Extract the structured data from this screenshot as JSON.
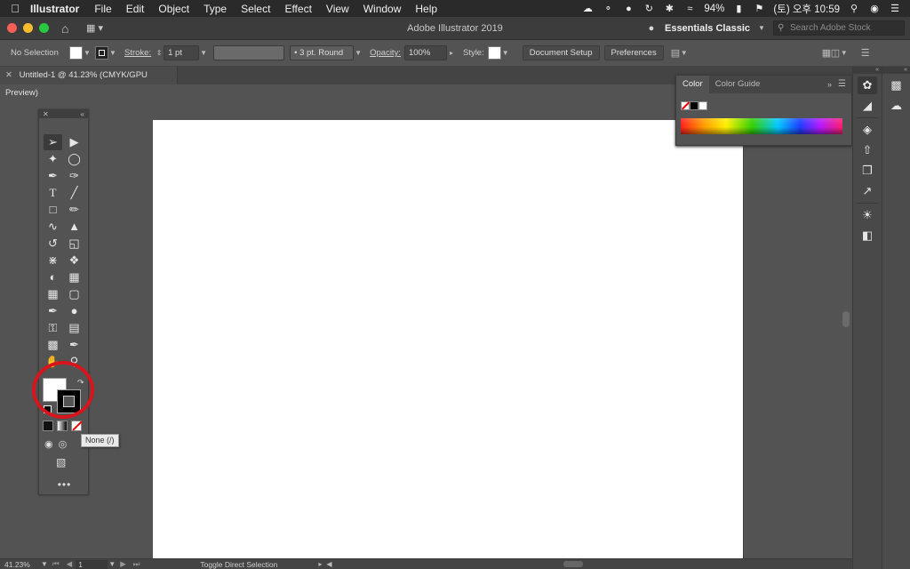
{
  "menubar": {
    "app_name": "Illustrator",
    "items": [
      "File",
      "Edit",
      "Object",
      "Type",
      "Select",
      "Effect",
      "View",
      "Window",
      "Help"
    ],
    "battery": "94%",
    "clock": "(토) 오후 10:59"
  },
  "titlebar": {
    "title": "Adobe Illustrator 2019",
    "workspace": "Essentials Classic",
    "search_placeholder": "Search Adobe Stock"
  },
  "controlbar": {
    "selection": "No Selection",
    "stroke_label": "Stroke:",
    "stroke_value": "1 pt",
    "brush": "3 pt. Round",
    "opacity_label": "Opacity:",
    "opacity_value": "100%",
    "style_label": "Style:",
    "doc_setup": "Document Setup",
    "preferences": "Preferences"
  },
  "document": {
    "tab_title": "Untitled-1 @ 41.23% (CMYK/GPU Preview)"
  },
  "toolbar": {
    "tooltip": "None (/)"
  },
  "color_panel": {
    "tabs": [
      "Color",
      "Color Guide"
    ]
  },
  "statusbar": {
    "zoom": "41.23%",
    "page": "1",
    "status": "Toggle Direct Selection"
  },
  "colors": {
    "accent_red": "#d7151c",
    "canvas": "#ffffff",
    "ui_bg": "#535353"
  }
}
